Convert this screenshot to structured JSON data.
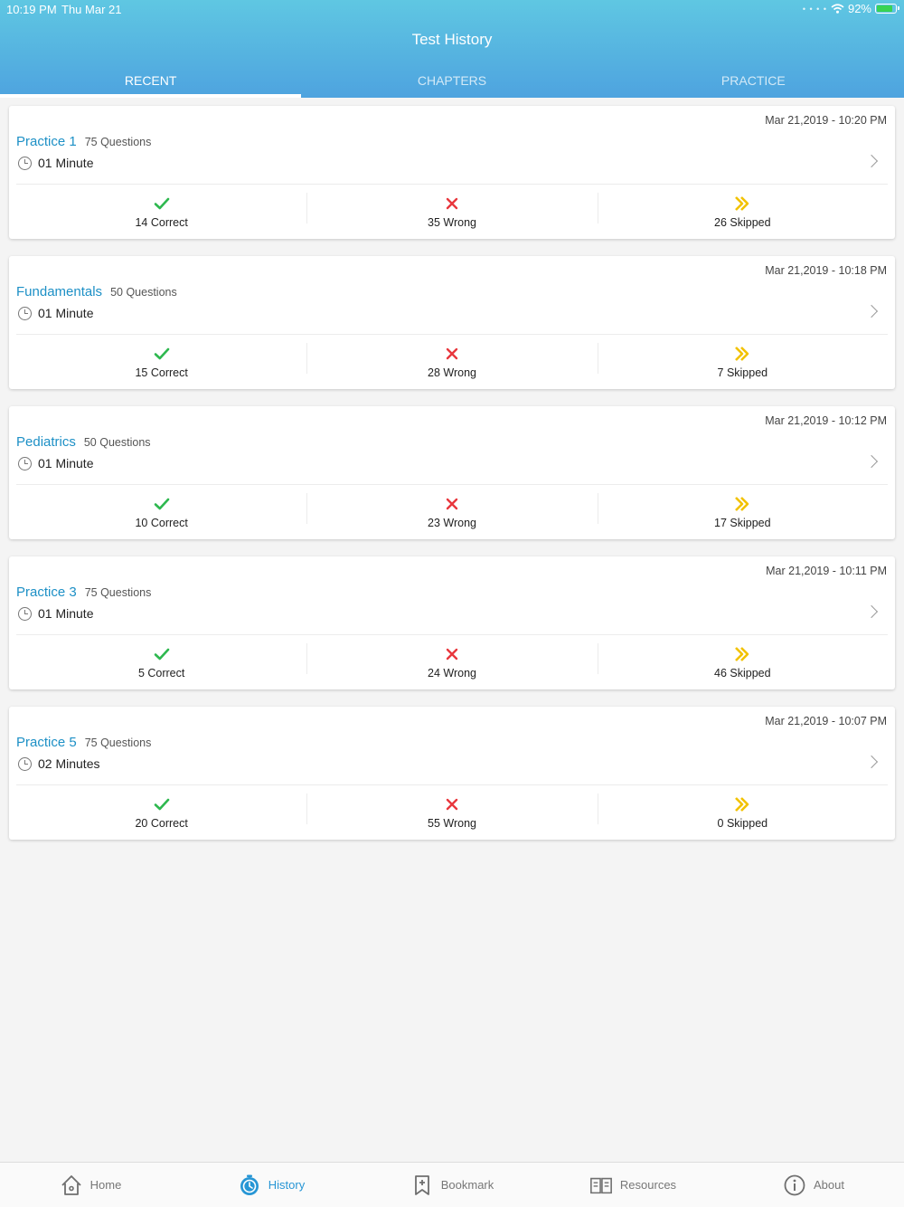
{
  "status_bar": {
    "time": "10:19 PM",
    "date": "Thu Mar 21",
    "battery": "92%",
    "battery_level": 0.92
  },
  "header": {
    "title": "Test History"
  },
  "tabs": [
    {
      "label": "RECENT",
      "active": true
    },
    {
      "label": "CHAPTERS",
      "active": false
    },
    {
      "label": "PRACTICE",
      "active": false
    }
  ],
  "colors": {
    "accent": "#1d90c6",
    "correct": "#2eb84f",
    "wrong": "#e8373d",
    "skipped": "#f2c200",
    "active_tab": "#2796d5"
  },
  "icons": {
    "correct": "check-icon",
    "wrong": "cross-icon",
    "skipped": "double-chevron-icon",
    "time": "clock-icon",
    "open": "chevron-right-icon"
  },
  "tests": [
    {
      "name": "Practice 1",
      "questions": "75 Questions",
      "datetime": "Mar 21,2019 - 10:20 PM",
      "duration": "01 Minute",
      "correct": "14 Correct",
      "wrong": "35 Wrong",
      "skipped": "26 Skipped"
    },
    {
      "name": "Fundamentals",
      "questions": "50 Questions",
      "datetime": "Mar 21,2019 - 10:18 PM",
      "duration": "01 Minute",
      "correct": "15 Correct",
      "wrong": "28 Wrong",
      "skipped": "7 Skipped"
    },
    {
      "name": "Pediatrics",
      "questions": "50 Questions",
      "datetime": "Mar 21,2019 - 10:12 PM",
      "duration": "01 Minute",
      "correct": "10 Correct",
      "wrong": "23 Wrong",
      "skipped": "17 Skipped"
    },
    {
      "name": "Practice 3",
      "questions": "75 Questions",
      "datetime": "Mar 21,2019 - 10:11 PM",
      "duration": "01 Minute",
      "correct": "5 Correct",
      "wrong": "24 Wrong",
      "skipped": "46 Skipped"
    },
    {
      "name": "Practice 5",
      "questions": "75 Questions",
      "datetime": "Mar 21,2019 - 10:07 PM",
      "duration": "02 Minutes",
      "correct": "20 Correct",
      "wrong": "55 Wrong",
      "skipped": "0 Skipped"
    }
  ],
  "bottom_nav": [
    {
      "label": "Home",
      "icon": "home-icon",
      "active": false
    },
    {
      "label": "History",
      "icon": "history-icon",
      "active": true
    },
    {
      "label": "Bookmark",
      "icon": "bookmark-icon",
      "active": false
    },
    {
      "label": "Resources",
      "icon": "book-icon",
      "active": false
    },
    {
      "label": "About",
      "icon": "info-icon",
      "active": false
    }
  ]
}
